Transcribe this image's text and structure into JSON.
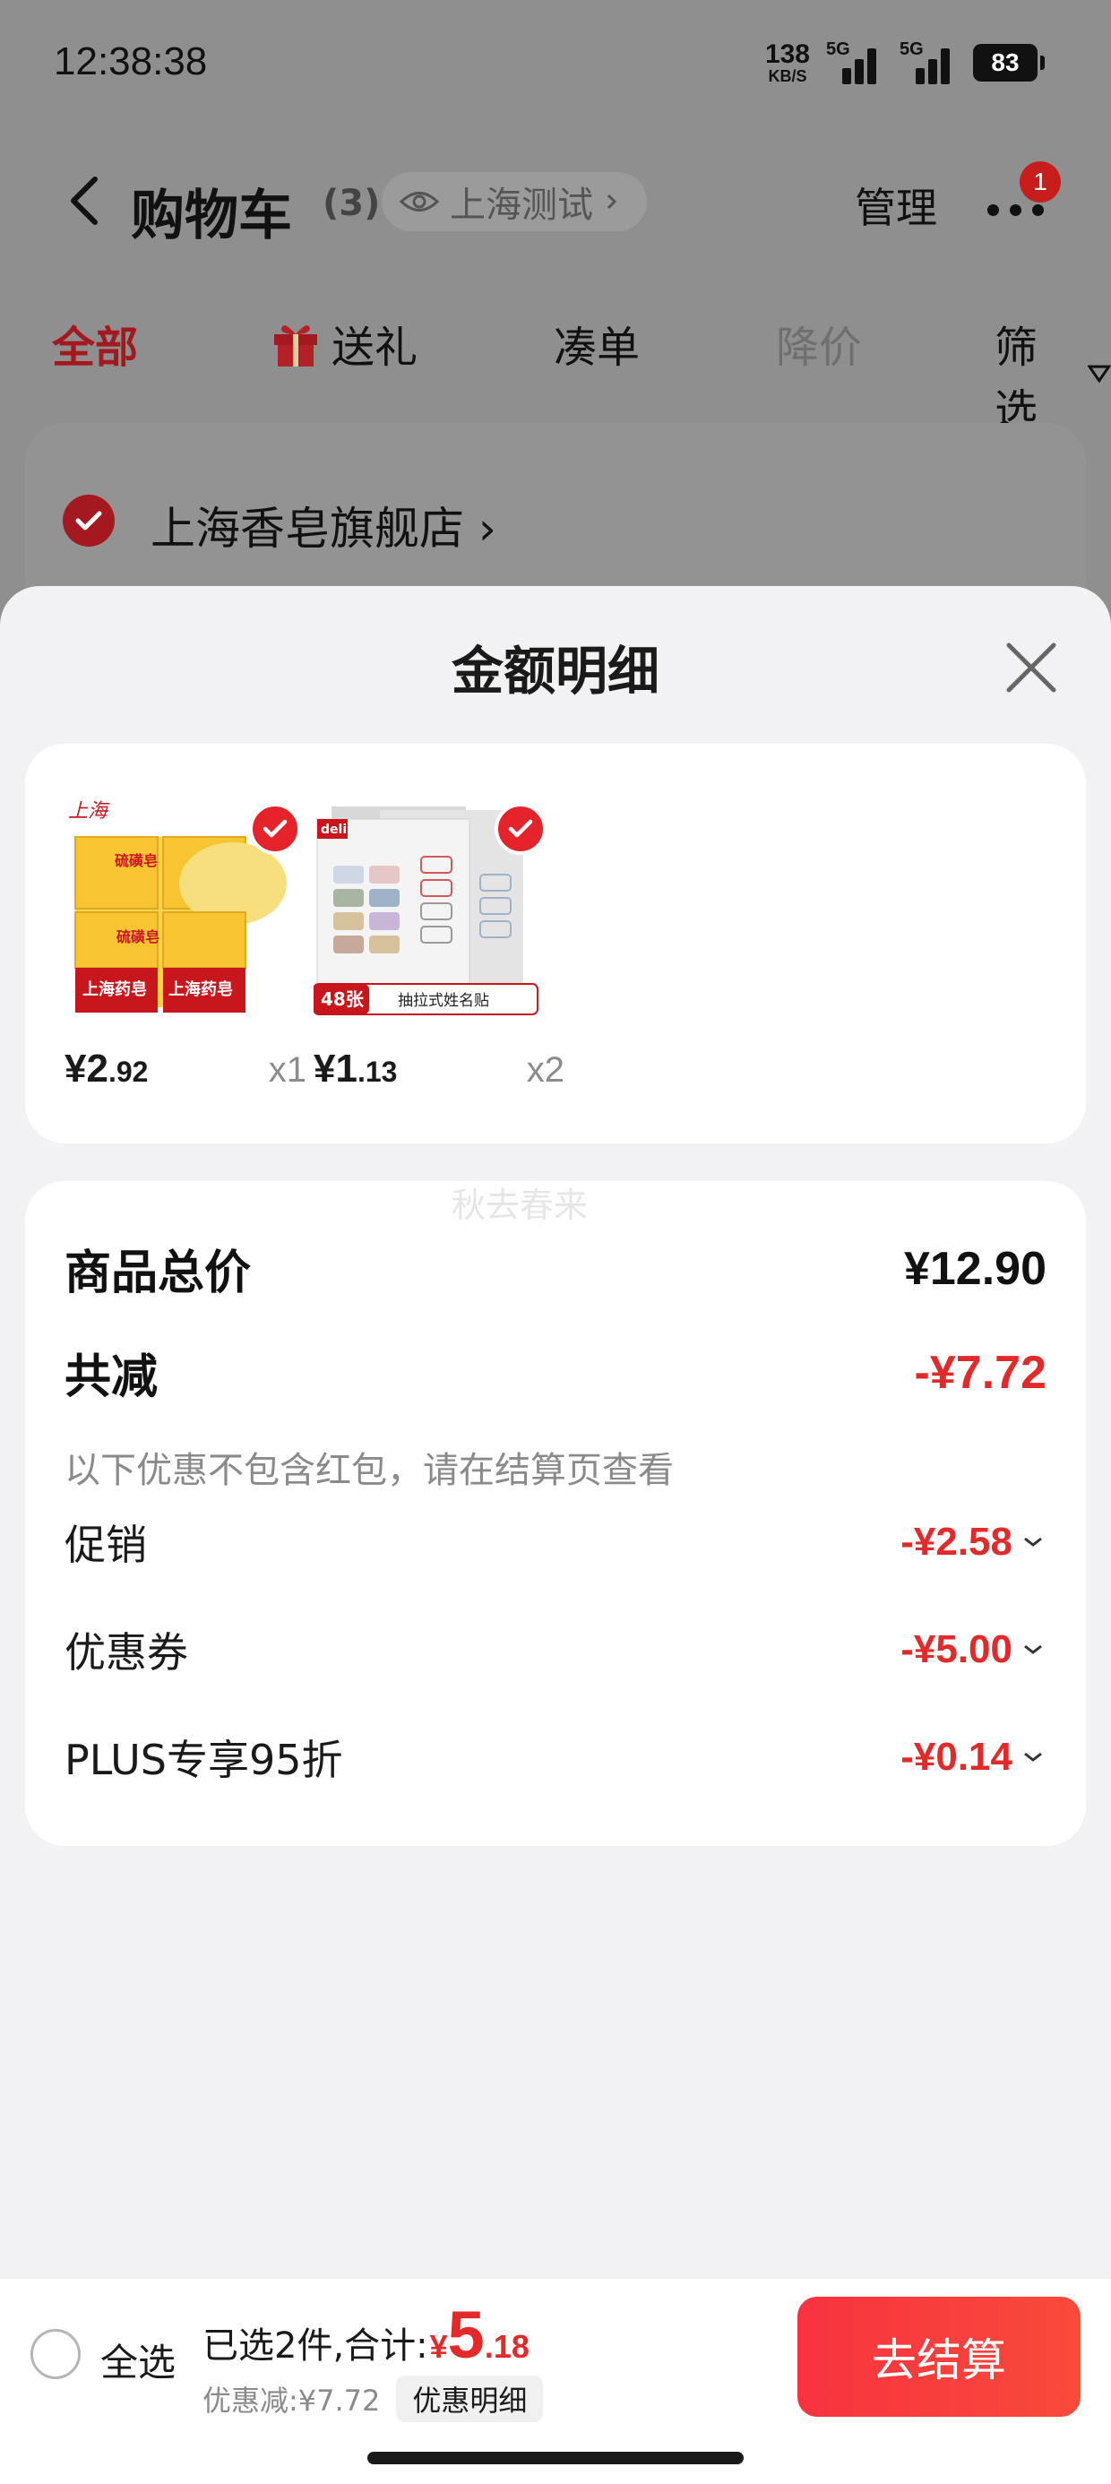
{
  "status_bar": {
    "time": "12:38:38",
    "net_speed_value": "138",
    "net_speed_unit": "KB/S",
    "signal1_label": "5G",
    "signal2_label": "5G",
    "battery": "83"
  },
  "header": {
    "title": "购物车",
    "count": "(3)",
    "location": "上海测试",
    "manage_label": "管理",
    "more_badge": "1"
  },
  "tabs": [
    {
      "label": "全部"
    },
    {
      "label": "送礼"
    },
    {
      "label": "凑单"
    },
    {
      "label": "降价"
    },
    {
      "label": "筛选"
    }
  ],
  "store": {
    "name": "上海香皂旗舰店 ›"
  },
  "sheet": {
    "title": "金额明细",
    "watermark": "秋去春来",
    "products": [
      {
        "icon": "soap-product-image",
        "brand_text": "上海",
        "pack_label": "硫磺皂",
        "box_label": "上海药皂",
        "price_int": "¥2",
        "price_dec": ".92",
        "qty": "x1"
      },
      {
        "icon": "name-sticker-product-image",
        "brand_text": "deli",
        "count_badge": "48张",
        "caption": "抽拉式姓名贴",
        "price_int": "¥1",
        "price_dec": ".13",
        "qty": "x2"
      }
    ],
    "summary": {
      "total_label": "商品总价",
      "total_value": "¥12.90",
      "reduce_label": "共减",
      "reduce_value": "-¥7.72",
      "note": "以下优惠不包含红包，请在结算页查看",
      "items": [
        {
          "label": "促销",
          "value": "-¥2.58"
        },
        {
          "label": "优惠券",
          "value": "-¥5.00"
        },
        {
          "label": "PLUS专享95折",
          "value": "-¥0.14"
        }
      ]
    }
  },
  "footer": {
    "select_all": "全选",
    "selected_text": "已选2件,合计:",
    "yen": "¥",
    "total_int": "5",
    "total_dec": ".18",
    "discount_text": "优惠减:¥7.72",
    "detail_button": "优惠明细",
    "checkout_button": "去结算"
  },
  "colors": {
    "accent_red": "#e32a2a",
    "dim_red": "#a3191f",
    "sheet_bg": "#f2f2f4"
  }
}
